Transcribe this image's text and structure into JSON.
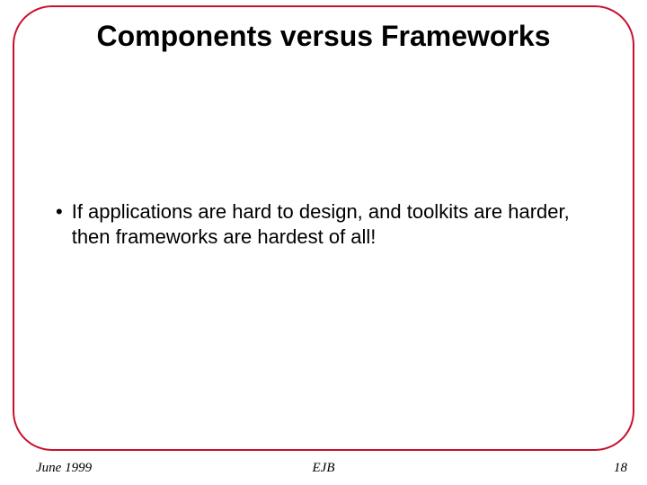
{
  "slide": {
    "title": "Components versus Frameworks",
    "bullets": [
      "If applications are hard to design, and toolkits are harder, then frameworks are hardest of all!"
    ]
  },
  "footer": {
    "date": "June 1999",
    "center": "EJB",
    "page": "18"
  }
}
